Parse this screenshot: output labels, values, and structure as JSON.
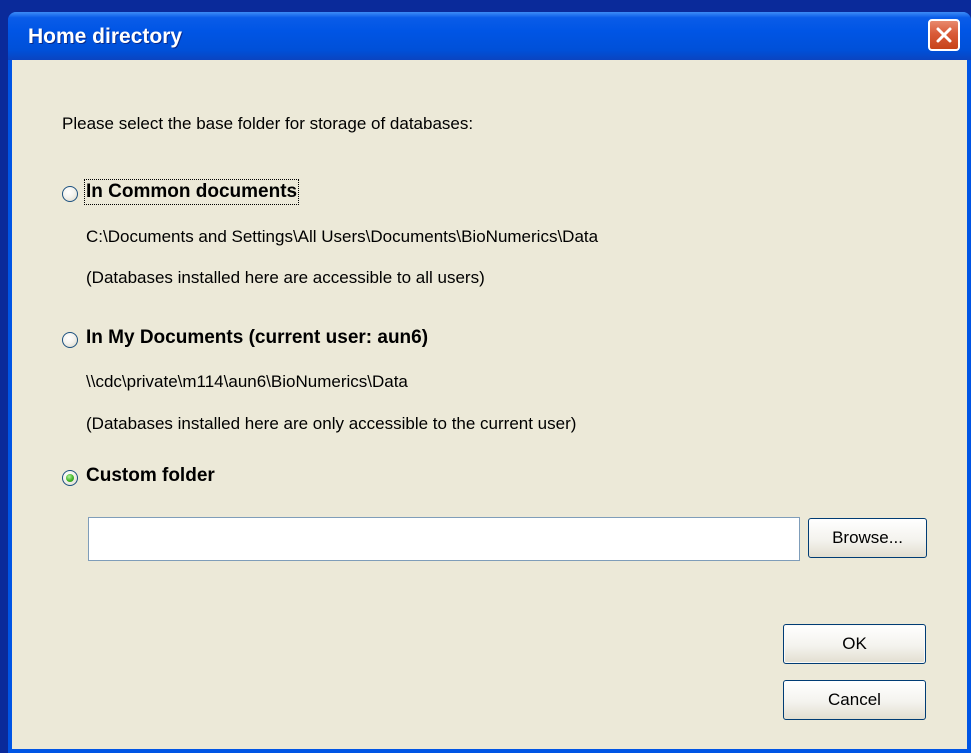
{
  "window": {
    "title": "Home directory",
    "close_icon": "close-icon"
  },
  "prompt": "Please select the base folder for storage of databases:",
  "options": [
    {
      "label": "In Common documents",
      "path": "C:\\Documents and Settings\\All Users\\Documents\\BioNumerics\\Data",
      "note": "(Databases installed here are accessible to all users)",
      "selected": false
    },
    {
      "label": "In My Documents (current user: aun6)",
      "path": "\\\\cdc\\private\\m114\\aun6\\BioNumerics\\Data",
      "note": "(Databases installed here are only accessible to the current user)",
      "selected": false
    },
    {
      "label": "Custom folder",
      "selected": true
    }
  ],
  "custom_folder": {
    "value": "",
    "browse_label": "Browse..."
  },
  "buttons": {
    "ok": "OK",
    "cancel": "Cancel"
  },
  "colors": {
    "titlebar": "#0055e5",
    "client_bg": "#ece9d8",
    "close_button": "#d95b38",
    "radio_selected_dot": "#41b528"
  }
}
